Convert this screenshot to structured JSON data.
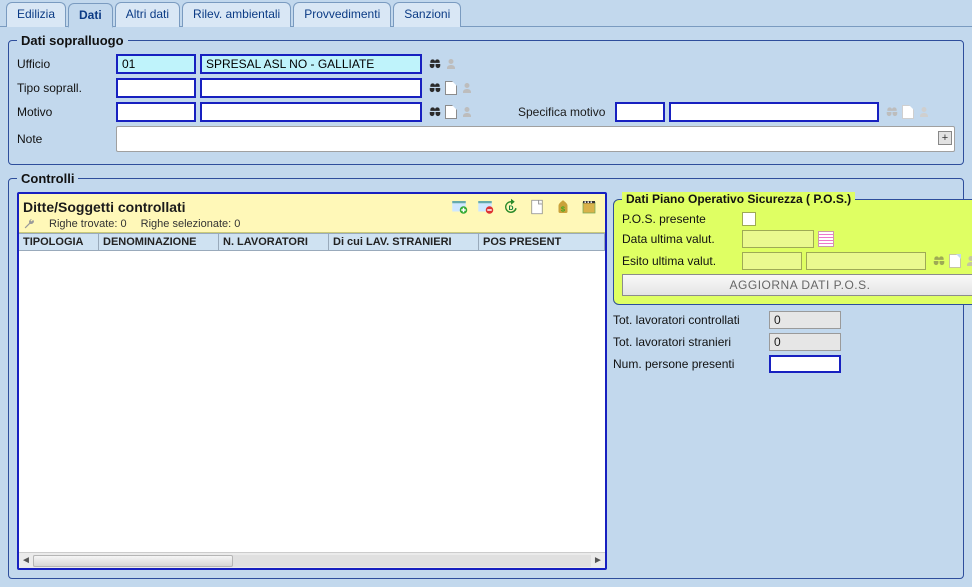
{
  "tabs": [
    "Edilizia",
    "Dati",
    "Altri dati",
    "Rilev. ambientali",
    "Provvedimenti",
    "Sanzioni"
  ],
  "active_tab": "Dati",
  "sopralluogo": {
    "legend": "Dati sopralluogo",
    "ufficio_label": "Ufficio",
    "ufficio_code": "01",
    "ufficio_desc": "SPRESAL ASL NO - GALLIATE",
    "tipo_label": "Tipo soprall.",
    "tipo_code": "",
    "tipo_desc": "",
    "motivo_label": "Motivo",
    "motivo_code": "",
    "motivo_desc": "",
    "spec_label": "Specifica motivo",
    "spec_code": "",
    "spec_desc": "",
    "note_label": "Note",
    "note_value": ""
  },
  "controlli": {
    "legend": "Controlli",
    "ditte_title": "Ditte/Soggetti controllati",
    "trovate_label": "Righe trovate:",
    "trovate_value": "0",
    "selez_label": "Righe selezionate:",
    "selez_value": "0",
    "columns": [
      "TIPOLOGIA",
      "DENOMINAZIONE",
      "N. LAVORATORI",
      "Di cui LAV. STRANIERI",
      "POS PRESENT"
    ]
  },
  "pos": {
    "legend": "Dati Piano Operativo Sicurezza ( P.O.S.)",
    "presente_label": "P.O.S. presente",
    "presente_checked": false,
    "data_label": "Data ultima valut.",
    "data_value": "",
    "esito_label": "Esito ultima valut.",
    "esito_code": "",
    "esito_desc": "",
    "aggiorna_label": "AGGIORNA DATI  P.O.S."
  },
  "summary": {
    "tot_lav_label": "Tot. lavoratori controllati",
    "tot_lav_value": "0",
    "tot_str_label": "Tot. lavoratori stranieri",
    "tot_str_value": "0",
    "num_pres_label": "Num. persone presenti",
    "num_pres_value": ""
  }
}
